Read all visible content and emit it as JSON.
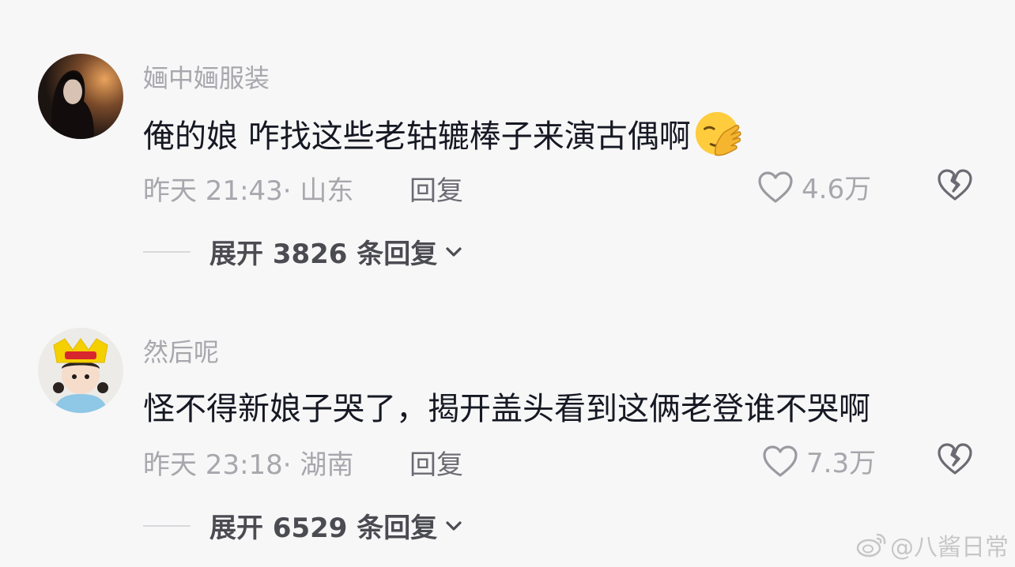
{
  "comments": [
    {
      "username": "婳中婳服装",
      "text": "俺的娘 咋找这些老轱辘棒子来演古偶啊",
      "emoji": "face-palm-emoji",
      "time": "昨天 21:43",
      "location": "· 山东",
      "reply_label": "回复",
      "likes": "4.6万",
      "expand_label": "展开 3826 条回复"
    },
    {
      "username": "然后呢",
      "text": "怪不得新娘子哭了，揭开盖头看到这俩老登谁不哭啊",
      "time": "昨天 23:18",
      "location": "· 湖南",
      "reply_label": "回复",
      "likes": "7.3万",
      "expand_label": "展开 6529 条回复"
    }
  ],
  "watermark": {
    "text": "@八酱日常",
    "icon": "weibo-icon"
  },
  "colors": {
    "background": "#f7f7f7",
    "primary_text": "#161823",
    "secondary_text": "#a7a7ad",
    "expand_text": "#4b4b52"
  }
}
